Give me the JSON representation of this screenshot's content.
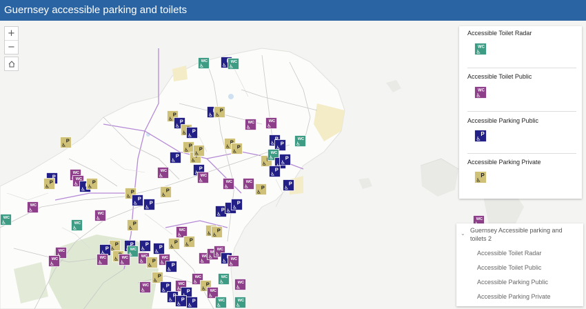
{
  "app": {
    "title": "Guernsey accessible parking and toilets"
  },
  "zoom_controls": {
    "zoom_in": "+",
    "zoom_out": "−"
  },
  "symbols": {
    "wc_label": "WC",
    "parking_label": "P",
    "wheelchair_glyph": "♿"
  },
  "colors": {
    "header": "#2b64a3",
    "toilet_radar": "#3e9b84",
    "toilet_public": "#8e3f8a",
    "parking_public": "#221f86",
    "parking_private": "#cfc177"
  },
  "legend": {
    "items": [
      {
        "label": "Accessible Toilet Radar",
        "type": "toilet_radar"
      },
      {
        "label": "Accessible Toilet Public",
        "type": "toilet_public"
      },
      {
        "label": "Accessible Parking Public",
        "type": "parking_public"
      },
      {
        "label": "Accessible Parking Private",
        "type": "parking_private"
      }
    ]
  },
  "layer_list": {
    "group_label": "Guernsey Accessible parking and toilets 2",
    "items": [
      "Accessible Toilet Radar",
      "Accessible Toilet Public",
      "Accessible Parking Public",
      "Accessible Parking Private"
    ]
  }
}
